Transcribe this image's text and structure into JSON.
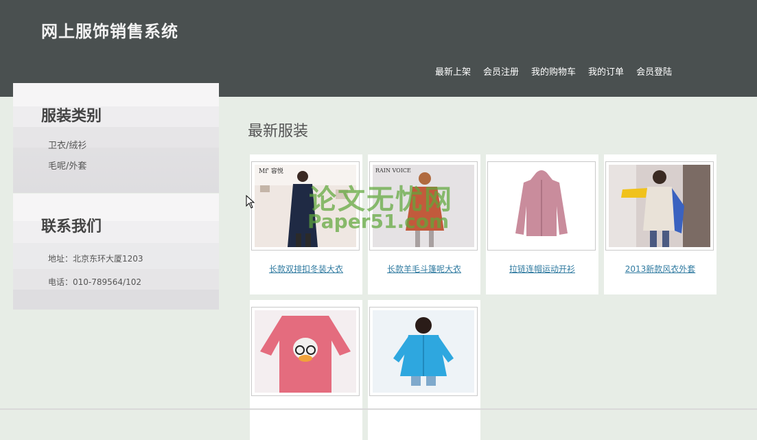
{
  "header": {
    "site_title": "网上服饰销售系统",
    "nav": [
      "最新上架",
      "会员注册",
      "我的购物车",
      "我的订单",
      "会员登陆"
    ]
  },
  "sidebar": {
    "category_title": "服装类别",
    "categories": [
      "卫衣/绒衫",
      "毛呢/外套"
    ],
    "contact_title": "联系我们",
    "address": "地址：北京东环大厦1203",
    "phone": "电话：010-789564/102"
  },
  "main": {
    "title": "最新服装",
    "products": [
      {
        "name": "长款双排扣冬装大衣"
      },
      {
        "name": "长款羊毛斗篷呢大衣"
      },
      {
        "name": "拉链连帽运动开衫"
      },
      {
        "name": "2013新款风衣外套"
      },
      {
        "name": ""
      },
      {
        "name": ""
      }
    ]
  },
  "watermark": {
    "line1": "论文无忧网",
    "line2": "Paper51.com"
  },
  "colors": {
    "header_bg": "#4a5050",
    "page_bg": "#e7ede6",
    "link": "#2f7aa0"
  }
}
